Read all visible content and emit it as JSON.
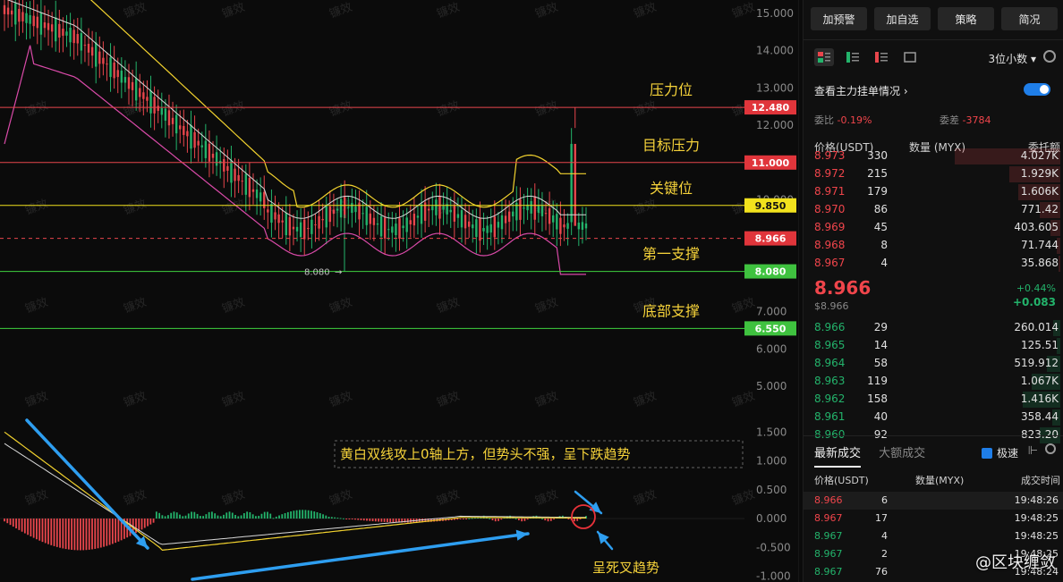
{
  "chart": {
    "price_ticks": [
      "15.000",
      "14.000",
      "13.000",
      "12.000",
      "11.000",
      "10.000",
      "9.000",
      "8.000",
      "7.000",
      "6.000",
      "5.000"
    ],
    "macd_ticks": [
      "1.500",
      "1.000",
      "0.500",
      "0.000",
      "-0.500",
      "-1.000"
    ],
    "levels": [
      {
        "name": "压力位",
        "price": "12.480",
        "color": "#e8464c",
        "badge_bg": "#e0353b",
        "badge_fg": "#ffffff",
        "style": "solid"
      },
      {
        "name": "目标压力",
        "price": "11.000",
        "color": "#e8464c",
        "badge_bg": "#e0353b",
        "badge_fg": "#ffffff",
        "style": "solid"
      },
      {
        "name": "关键位",
        "price": "9.850",
        "color": "#f2e21d",
        "badge_bg": "#f2e21d",
        "badge_fg": "#111111",
        "style": "solid"
      },
      {
        "name": "",
        "price": "8.966",
        "color": "#e8464c",
        "badge_bg": "#e0353b",
        "badge_fg": "#ffffff",
        "style": "dashed"
      },
      {
        "name": "第一支撑",
        "price": "8.080",
        "color": "#3fd23f",
        "badge_bg": "#3fc23f",
        "badge_fg": "#ffffff",
        "style": "solid"
      },
      {
        "name": "底部支撑",
        "price": "6.550",
        "color": "#3fd23f",
        "badge_bg": "#3fc23f",
        "badge_fg": "#ffffff",
        "style": "solid"
      }
    ],
    "low_marker": "8.080",
    "annotation_macd": "黄白双线攻上0轴上方，但势头不强，呈下跌趋势",
    "annotation_cross": "呈死叉趋势",
    "watermark": "镰效",
    "colors": {
      "up": "#23b36b",
      "down": "#e8464c",
      "yellow": "#f2d22e",
      "white": "#d8d8d8",
      "magenta": "#d94aa8",
      "arrow": "#2e9ef0",
      "annotation": "#f5d23a"
    }
  },
  "panel": {
    "buttons": [
      "加预警",
      "加自选",
      "策略",
      "简况"
    ],
    "view_icons": [
      "orderbook-both-icon",
      "orderbook-bids-icon",
      "orderbook-asks-icon",
      "orderbook-compact-icon"
    ],
    "decimals": "3位小数",
    "mainforce": "查看主力挂单情况",
    "ratio_label": "委比",
    "ratio_value": "-0.19%",
    "diff_label": "委差",
    "diff_value": "-3784",
    "ob_headers": [
      "价格(USDT)",
      "数量 (MYX)",
      "委托额"
    ],
    "asks": [
      {
        "price": "8.973",
        "qty": "330",
        "amount": "4.027K",
        "bar": 0.62
      },
      {
        "price": "8.972",
        "qty": "215",
        "amount": "1.929K",
        "bar": 0.3
      },
      {
        "price": "8.971",
        "qty": "179",
        "amount": "1.606K",
        "bar": 0.25
      },
      {
        "price": "8.970",
        "qty": "86",
        "amount": "771.42",
        "bar": 0.12
      },
      {
        "price": "8.969",
        "qty": "45",
        "amount": "403.605",
        "bar": 0.06
      },
      {
        "price": "8.968",
        "qty": "8",
        "amount": "71.744",
        "bar": 0.02
      },
      {
        "price": "8.967",
        "qty": "4",
        "amount": "35.868",
        "bar": 0.01
      }
    ],
    "last_price": "8.966",
    "last_usd": "$8.966",
    "change_pct": "+0.44%",
    "change_abs": "+0.083",
    "bids": [
      {
        "price": "8.966",
        "qty": "29",
        "amount": "260.014",
        "bar": 0.04
      },
      {
        "price": "8.965",
        "qty": "14",
        "amount": "125.51",
        "bar": 0.02
      },
      {
        "price": "8.964",
        "qty": "58",
        "amount": "519.912",
        "bar": 0.08
      },
      {
        "price": "8.963",
        "qty": "119",
        "amount": "1.067K",
        "bar": 0.17
      },
      {
        "price": "8.962",
        "qty": "158",
        "amount": "1.416K",
        "bar": 0.22
      },
      {
        "price": "8.961",
        "qty": "40",
        "amount": "358.44",
        "bar": 0.05
      },
      {
        "price": "8.960",
        "qty": "92",
        "amount": "823.20",
        "bar": 0.12
      }
    ],
    "trades_tabs": [
      "最新成交",
      "大额成交"
    ],
    "speed_label": "极速",
    "tr_headers": [
      "价格(USDT)",
      "数量(MYX)",
      "成交时间"
    ],
    "trades": [
      {
        "price": "8.966",
        "qty": "6",
        "time": "19:48:26",
        "side": "down"
      },
      {
        "price": "8.967",
        "qty": "17",
        "time": "19:48:25",
        "side": "down"
      },
      {
        "price": "8.967",
        "qty": "4",
        "time": "19:48:25",
        "side": "up"
      },
      {
        "price": "8.967",
        "qty": "2",
        "time": "19:48:25",
        "side": "up"
      },
      {
        "price": "8.967",
        "qty": "76",
        "time": "19:48:24",
        "side": "up"
      }
    ],
    "brand": "@区块缠敛"
  }
}
